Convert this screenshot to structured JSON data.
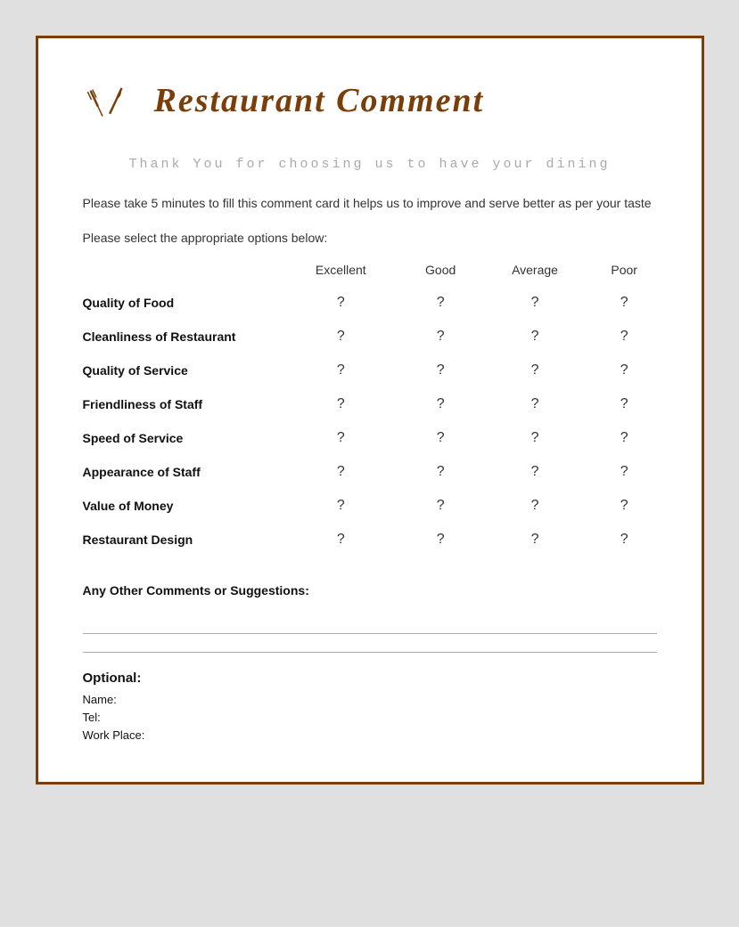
{
  "header": {
    "icon_symbol": "🍴",
    "title": "Restaurant Comment"
  },
  "thank_you_text": "Thank You for choosing us to have your\ndining",
  "description": "Please take 5 minutes to fill this comment card it helps us to improve and serve better as per your taste",
  "select_prompt": "Please select the appropriate options below:",
  "table": {
    "columns": [
      "",
      "Excellent",
      "Good",
      "Average",
      "Poor"
    ],
    "rows": [
      {
        "label": "Quality of Food",
        "values": [
          "?",
          "?",
          "?",
          "?"
        ]
      },
      {
        "label": "Cleanliness of Restaurant",
        "values": [
          "?",
          "?",
          "?",
          "?"
        ]
      },
      {
        "label": "Quality of Service",
        "values": [
          "?",
          "?",
          "?",
          "?"
        ]
      },
      {
        "label": "Friendliness of Staff",
        "values": [
          "?",
          "?",
          "?",
          "?"
        ]
      },
      {
        "label": "Speed of Service",
        "values": [
          "?",
          "?",
          "?",
          "?"
        ]
      },
      {
        "label": "Appearance of Staff",
        "values": [
          "?",
          "?",
          "?",
          "?"
        ]
      },
      {
        "label": "Value of Money",
        "values": [
          "?",
          "?",
          "?",
          "?"
        ]
      },
      {
        "label": "Restaurant Design",
        "values": [
          "?",
          "?",
          "?",
          "?"
        ]
      }
    ]
  },
  "comments": {
    "label": "Any Other Comments or Suggestions:"
  },
  "optional": {
    "title": "Optional:",
    "fields": [
      "Name:",
      "Tel:",
      "Work Place:"
    ]
  }
}
